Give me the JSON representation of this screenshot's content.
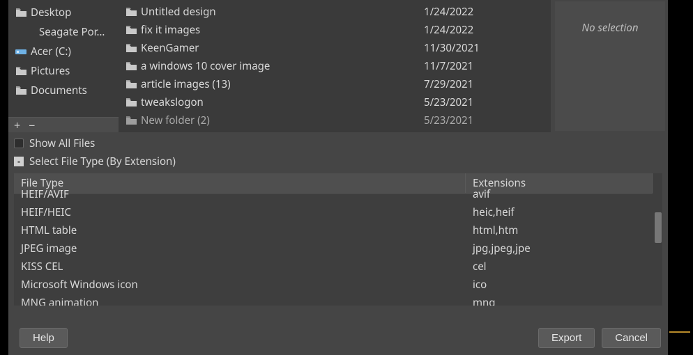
{
  "places": [
    {
      "name": "Desktop",
      "icon": "folder",
      "indent": false
    },
    {
      "name": "Seagate Por…",
      "icon": "none",
      "indent": true
    },
    {
      "name": "Acer (C:)",
      "icon": "drive",
      "indent": false
    },
    {
      "name": "Pictures",
      "icon": "folder",
      "indent": false
    },
    {
      "name": "Documents",
      "icon": "folder",
      "indent": false
    }
  ],
  "files": [
    {
      "name": "Untitled design",
      "date": "1/24/2022"
    },
    {
      "name": "fix it images",
      "date": "1/24/2022"
    },
    {
      "name": "KeenGamer",
      "date": "11/30/2021"
    },
    {
      "name": "a windows 10 cover image",
      "date": "11/7/2021"
    },
    {
      "name": "article images (13)",
      "date": "7/29/2021"
    },
    {
      "name": "tweakslogon",
      "date": "5/23/2021"
    },
    {
      "name": "New folder (2)",
      "date": "5/23/2021"
    }
  ],
  "preview": {
    "no_selection": "No selection"
  },
  "options": {
    "show_all_files": "Show All Files",
    "select_file_type": "Select File Type (By Extension)"
  },
  "type_table": {
    "headers": {
      "file_type": "File Type",
      "extensions": "Extensions"
    },
    "rows": [
      {
        "type": "HEIF/AVIF",
        "ext": "avif"
      },
      {
        "type": "HEIF/HEIC",
        "ext": "heic,heif"
      },
      {
        "type": "HTML table",
        "ext": "html,htm"
      },
      {
        "type": "JPEG image",
        "ext": "jpg,jpeg,jpe"
      },
      {
        "type": "KISS CEL",
        "ext": "cel"
      },
      {
        "type": "Microsoft Windows icon",
        "ext": "ico"
      },
      {
        "type": "MNG animation",
        "ext": "mng"
      }
    ]
  },
  "buttons": {
    "help": "Help",
    "export": "Export",
    "cancel": "Cancel"
  }
}
